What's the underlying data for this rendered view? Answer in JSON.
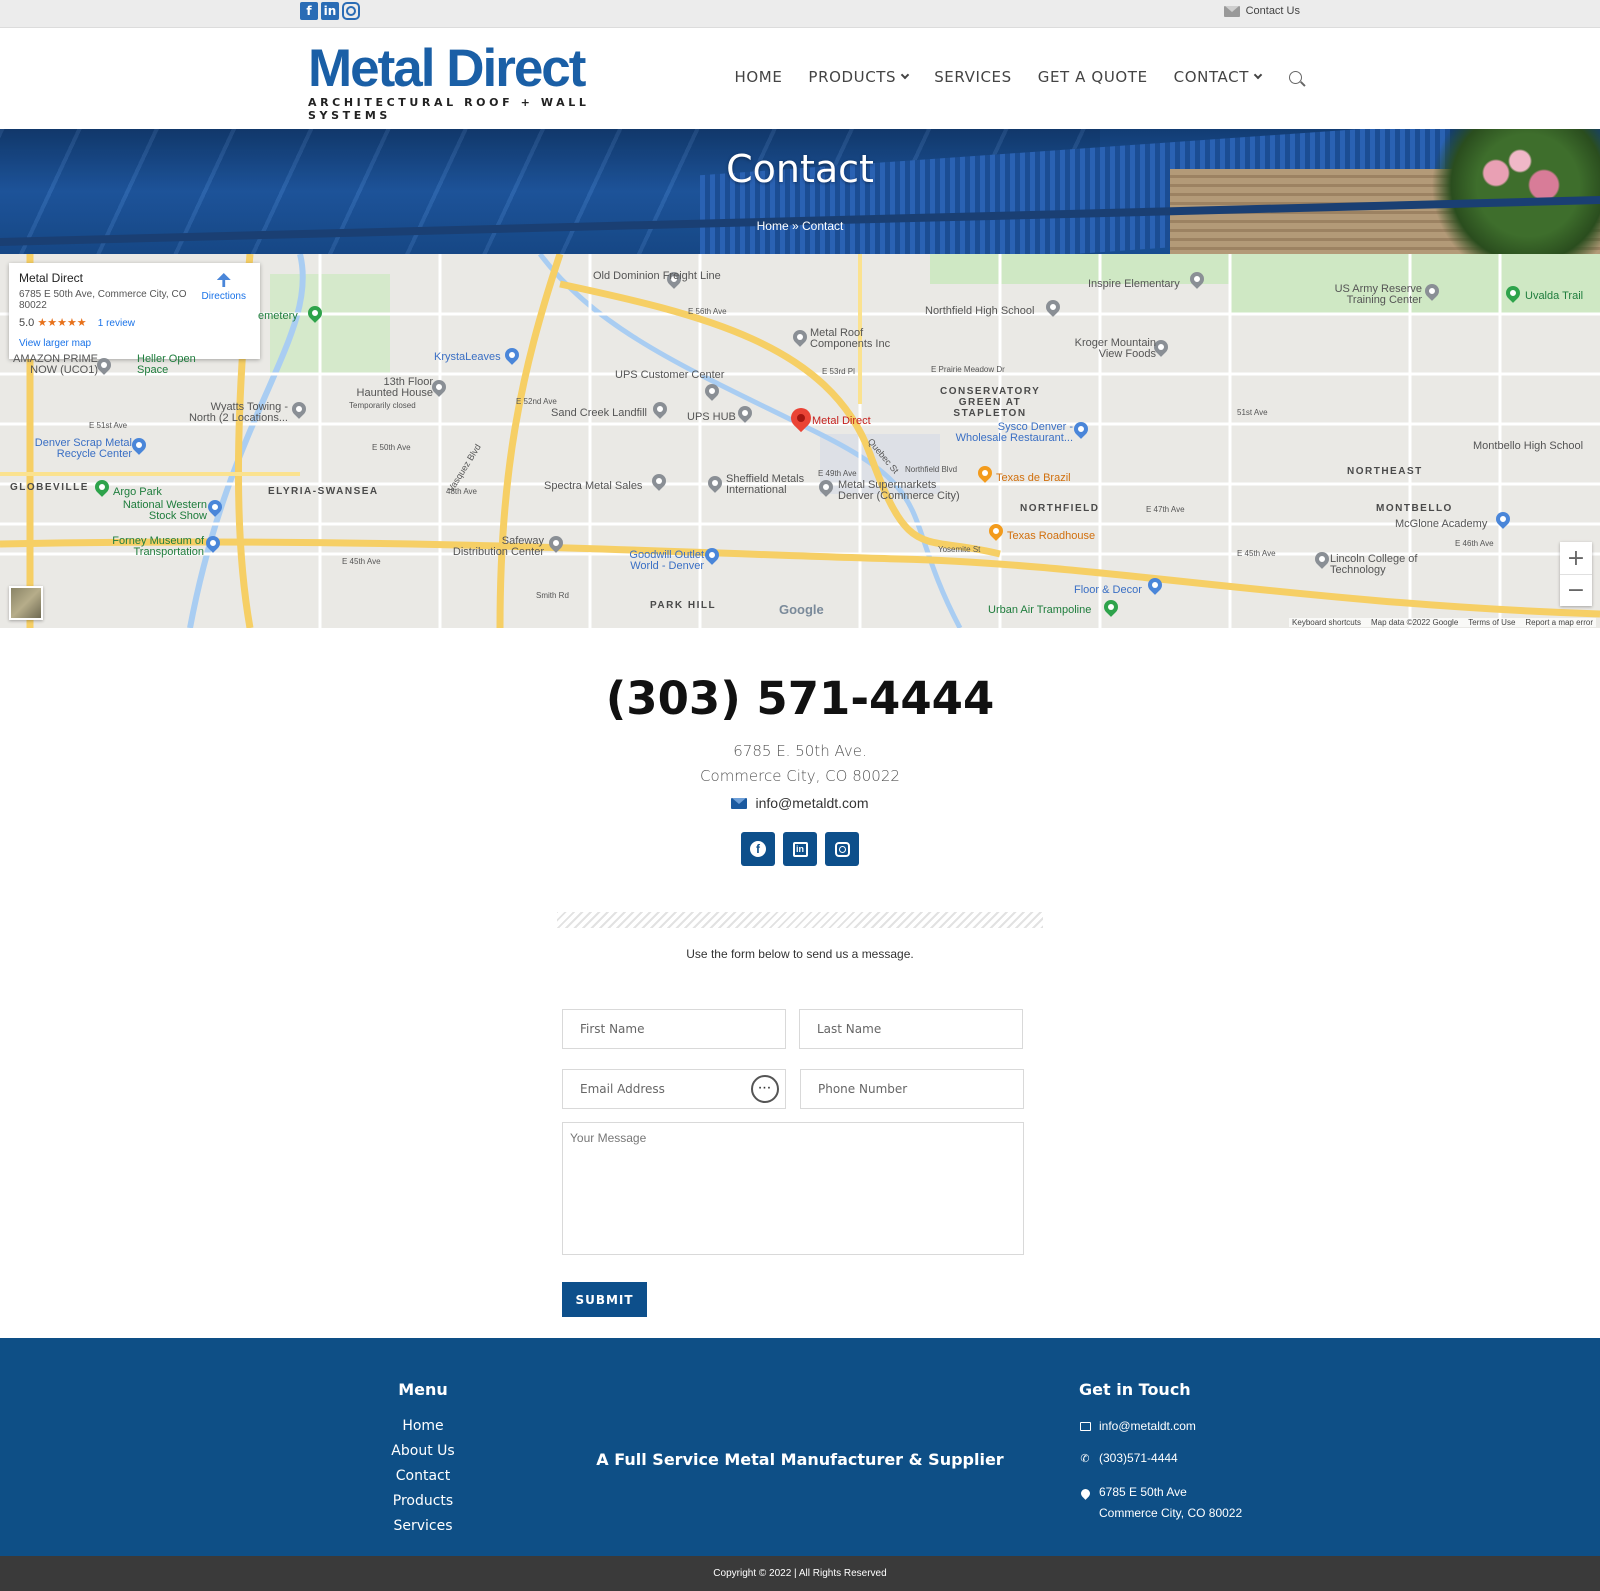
{
  "topbar": {
    "social_icons": [
      "facebook-icon",
      "linkedin-icon",
      "instagram-icon"
    ],
    "contact_link": "Contact Us"
  },
  "header": {
    "logo_title": "Metal Direct",
    "logo_subtitle": "ARCHITECTURAL ROOF + WALL SYSTEMS",
    "nav": [
      {
        "label": "HOME",
        "dropdown": false
      },
      {
        "label": "PRODUCTS",
        "dropdown": true
      },
      {
        "label": "SERVICES",
        "dropdown": false
      },
      {
        "label": "GET A QUOTE",
        "dropdown": false
      },
      {
        "label": "CONTACT",
        "dropdown": true
      }
    ]
  },
  "hero": {
    "title": "Contact",
    "breadcrumb_home": "Home",
    "breadcrumb_sep": "»",
    "breadcrumb_current": "Contact"
  },
  "map": {
    "card": {
      "name": "Metal Direct",
      "address": "6785 E 50th Ave, Commerce City, CO 80022",
      "rating": "5.0",
      "stars": "★★★★★",
      "reviews": "1 review",
      "larger_map": "View larger map",
      "directions": "Directions"
    },
    "places": [
      "Old Dominion Freight Line",
      "Inspire Elementary",
      "US Army Reserve Training Center",
      "Uvalda Trail",
      "Northfield High School",
      "Metal Roof Components Inc",
      "Kroger Mountain View Foods",
      "KrystaLeaves",
      "UPS Customer Center",
      "13th Floor Haunted House",
      "Temporarily closed",
      "Wyatts Towing - North (2 Locations...",
      "Sand Creek Landfill",
      "UPS HUB",
      "Metal Direct",
      "CONSERVATORY GREEN AT STAPLETON",
      "Sysco Denver - Wholesale Restaurant...",
      "Denver Scrap Metal Recycle Center",
      "NORTHEAST",
      "Montbello High School",
      "GLOBEVILLE",
      "ELYRIA-SWANSEA",
      "Argo Park",
      "National Western Stock Show",
      "Spectra Metal Sales",
      "Sheffield Metals International",
      "Metal Supermarkets Denver (Commerce City)",
      "Texas de Brazil",
      "NORTHFIELD",
      "MONTBELLO",
      "McGlone Academy",
      "Texas Roadhouse",
      "Forney Museum of Transportation",
      "Safeway Distribution Center",
      "Goodwill Outlet World - Denver",
      "Lincoln College of Technology",
      "Floor & Decor",
      "PARK HILL",
      "Urban Air Trampoline",
      "AMAZON PRIME NOW (UCO1)",
      "Heller Open Space",
      "emetery"
    ],
    "streets": [
      "E 56th Ave",
      "E 53rd Pl",
      "E 52nd Ave",
      "E 51st Ave",
      "E 50th Ave",
      "48th Ave",
      "E 49th Ave",
      "E 45th Ave",
      "Smith Rd",
      "Vasquez Blvd",
      "Quebec St",
      "Northfield Blvd",
      "51st Ave",
      "E 47th Ave",
      "E 45th Ave",
      "E 46th Ave",
      "Yosemite St",
      "E Prairie Meadow Dr"
    ],
    "google": "Google",
    "attribution": [
      "Keyboard shortcuts",
      "Map data ©2022 Google",
      "Terms of Use",
      "Report a map error"
    ],
    "zoom_in": "+",
    "zoom_out": "−"
  },
  "contact": {
    "phone": "(303) 571-4444",
    "address_line1": "6785 E. 50th Ave.",
    "address_line2": "Commerce City, CO 80022",
    "email": "info@metaldt.com",
    "social_icons": [
      "facebook-icon",
      "linkedin-icon",
      "instagram-icon"
    ],
    "intro": "Use the form below to send us a message."
  },
  "form": {
    "first_name_placeholder": "First Name",
    "last_name_placeholder": "Last Name",
    "email_placeholder": "Email Address",
    "phone_placeholder": "Phone Number",
    "message_placeholder": "Your Message",
    "submit_label": "SUBMIT"
  },
  "footer": {
    "menu_title": "Menu",
    "menu": [
      "Home",
      "About Us",
      "Contact",
      "Products",
      "Services"
    ],
    "tagline": "A Full Service Metal Manufacturer & Supplier",
    "get_in_touch_title": "Get in Touch",
    "email": "info@metaldt.com",
    "phone": "(303)571-4444",
    "address_line1": "6785 E 50th Ave",
    "address_line2": "Commerce City, CO 80022",
    "copyright": "Copyright © 2022 | All Rights Reserved"
  },
  "colors": {
    "brand_blue": "#1a5fa6",
    "footer_blue": "#0e4f86",
    "button_blue": "#0d4f8b",
    "copyright_bar": "#3a3a3a"
  }
}
